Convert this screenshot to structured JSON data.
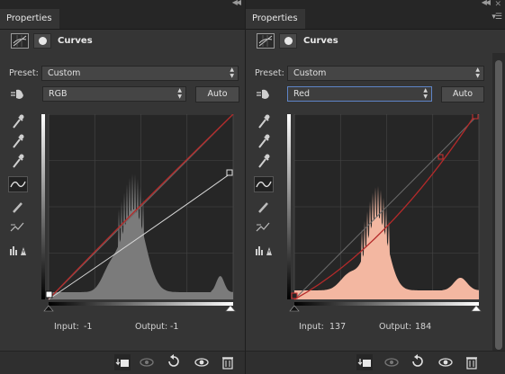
{
  "left": {
    "tab": "Properties",
    "title": "Curves",
    "preset_label": "Preset:",
    "preset_value": "Custom",
    "channel": "RGB",
    "auto_label": "Auto",
    "input_label": "Input:",
    "input_value": "-1",
    "output_label": "Output:",
    "output_value": "-1"
  },
  "right": {
    "tab": "Properties",
    "title": "Curves",
    "preset_label": "Preset:",
    "preset_value": "Custom",
    "channel": "Red",
    "auto_label": "Auto",
    "input_label": "Input:",
    "input_value": "137",
    "output_label": "Output:",
    "output_value": "184"
  },
  "icons": {
    "collapse": "double-chevron-icon",
    "close": "close-icon",
    "menu": "panel-menu-icon",
    "tools": [
      "hand-target-icon",
      "black-eyedropper-icon",
      "gray-eyedropper-icon",
      "white-eyedropper-icon",
      "curve-tool-icon",
      "pencil-icon",
      "smooth-icon",
      "clipping-warning-icon"
    ],
    "bottom": [
      "clip-to-layer-icon",
      "view-previous-icon",
      "reset-icon",
      "visibility-eye-icon",
      "delete-icon"
    ]
  },
  "colors": {
    "panel_bg": "#353535",
    "graph_bg": "#262626",
    "red_curve": "#b52a2a",
    "histogram_gray": "#7b7b7b",
    "histogram_red": "#f3b7a1",
    "selection_border": "#5e84c7"
  }
}
